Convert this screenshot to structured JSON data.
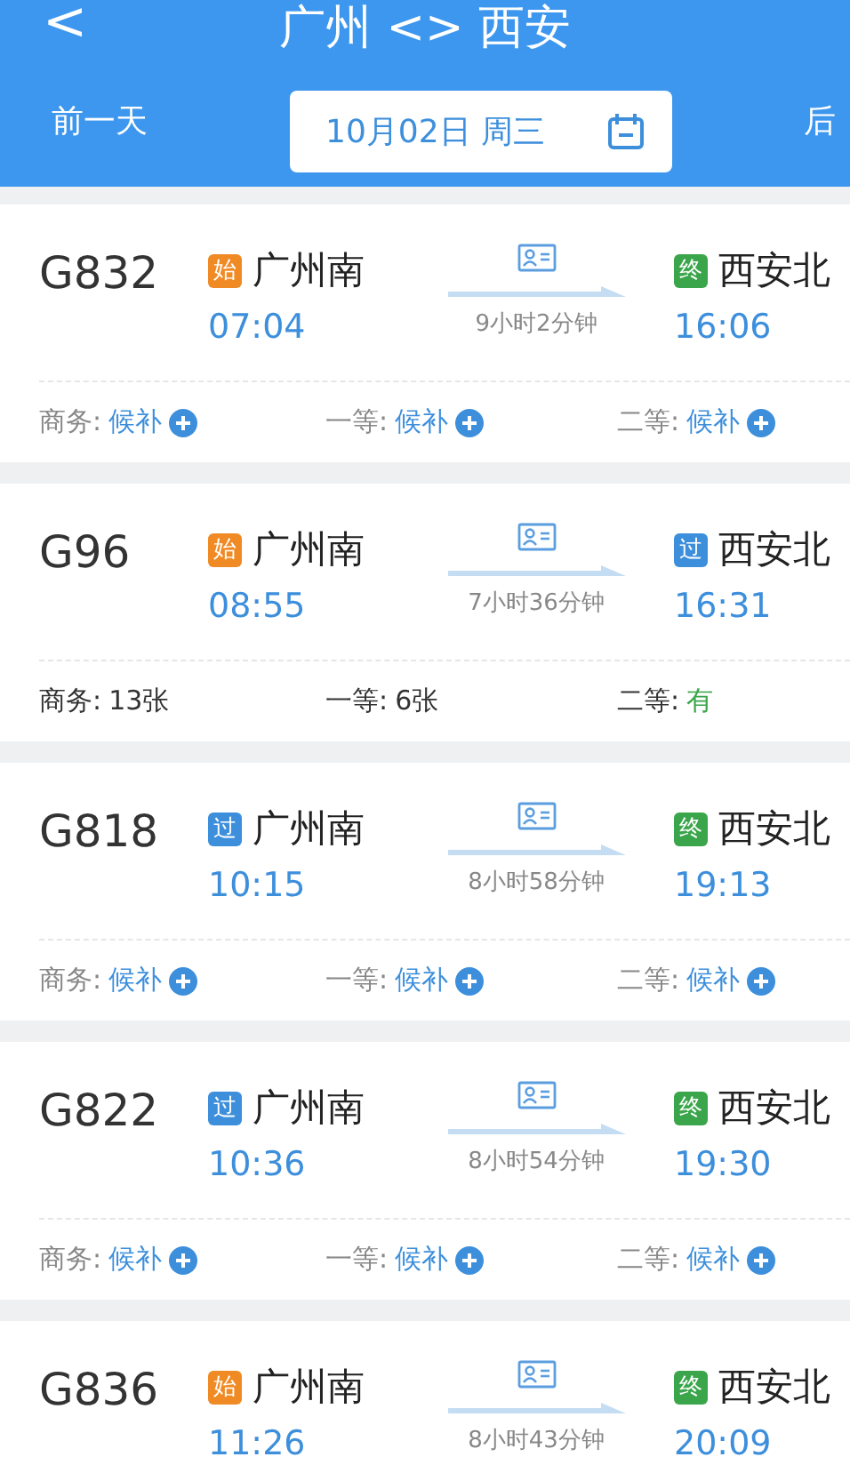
{
  "header": {
    "back": "<",
    "title": "广州 <> 西安",
    "prev_day": "前一天",
    "date": "10月02日 周三",
    "next_day": "后"
  },
  "trains": [
    {
      "number": "G832",
      "from": {
        "badge": "始",
        "kind": "start",
        "name": "广州南",
        "time": "07:04"
      },
      "duration": "9小时2分钟",
      "to": {
        "badge": "终",
        "kind": "end",
        "name": "西安北",
        "time": "16:06"
      },
      "seats": [
        {
          "label": "商务:",
          "value": "候补",
          "kind": "waitlist"
        },
        {
          "label": "一等:",
          "value": "候补",
          "kind": "waitlist"
        },
        {
          "label": "二等:",
          "value": "候补",
          "kind": "waitlist"
        }
      ]
    },
    {
      "number": "G96",
      "from": {
        "badge": "始",
        "kind": "start",
        "name": "广州南",
        "time": "08:55"
      },
      "duration": "7小时36分钟",
      "to": {
        "badge": "过",
        "kind": "pass",
        "name": "西安北",
        "time": "16:31"
      },
      "seats": [
        {
          "label": "商务:",
          "value": "13张",
          "kind": "count"
        },
        {
          "label": "一等:",
          "value": "6张",
          "kind": "count"
        },
        {
          "label": "二等:",
          "value": "有",
          "kind": "available"
        }
      ]
    },
    {
      "number": "G818",
      "from": {
        "badge": "过",
        "kind": "pass",
        "name": "广州南",
        "time": "10:15"
      },
      "duration": "8小时58分钟",
      "to": {
        "badge": "终",
        "kind": "end",
        "name": "西安北",
        "time": "19:13"
      },
      "seats": [
        {
          "label": "商务:",
          "value": "候补",
          "kind": "waitlist"
        },
        {
          "label": "一等:",
          "value": "候补",
          "kind": "waitlist"
        },
        {
          "label": "二等:",
          "value": "候补",
          "kind": "waitlist"
        }
      ]
    },
    {
      "number": "G822",
      "from": {
        "badge": "过",
        "kind": "pass",
        "name": "广州南",
        "time": "10:36"
      },
      "duration": "8小时54分钟",
      "to": {
        "badge": "终",
        "kind": "end",
        "name": "西安北",
        "time": "19:30"
      },
      "seats": [
        {
          "label": "商务:",
          "value": "候补",
          "kind": "waitlist"
        },
        {
          "label": "一等:",
          "value": "候补",
          "kind": "waitlist"
        },
        {
          "label": "二等:",
          "value": "候补",
          "kind": "waitlist"
        }
      ]
    },
    {
      "number": "G836",
      "from": {
        "badge": "始",
        "kind": "start",
        "name": "广州南",
        "time": "11:26"
      },
      "duration": "8小时43分钟",
      "to": {
        "badge": "终",
        "kind": "end",
        "name": "西安北",
        "time": "20:09"
      }
    }
  ]
}
